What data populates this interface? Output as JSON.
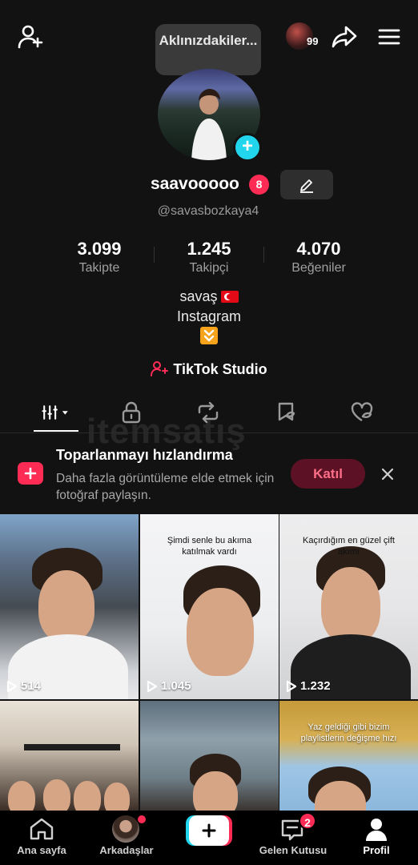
{
  "top_bar": {
    "thought_bubble": "Aklınızdakiler...",
    "mini_avatar_count": "99"
  },
  "profile": {
    "username": "saavooooo",
    "badge_count": "8",
    "handle": "@savasbozkaya4",
    "stats": [
      {
        "value": "3.099",
        "label": "Takipte"
      },
      {
        "value": "1.245",
        "label": "Takipçi"
      },
      {
        "value": "4.070",
        "label": "Beğeniler"
      }
    ],
    "bio_line1": "savaş",
    "bio_line2": "Instagram",
    "studio_label": "TikTok Studio"
  },
  "tabs": [
    "videos-tab",
    "private-tab",
    "reposts-tab",
    "favorites-tab",
    "liked-tab"
  ],
  "watermark": "itemsatış",
  "promo": {
    "title": "Toparlanmayı hızlandırma",
    "text": "Daha fazla görüntüleme elde etmek için fotoğraf paylaşın.",
    "button": "Katıl"
  },
  "videos": [
    {
      "views": "514",
      "caption": ""
    },
    {
      "views": "1.045",
      "caption": "Şimdi senle bu akıma katılmak vardı"
    },
    {
      "views": "1.232",
      "caption": "Kaçırdığım en güzel çift akımı"
    },
    {
      "views": "",
      "caption": ""
    },
    {
      "views": "",
      "caption": ""
    },
    {
      "views": "",
      "caption": "Yaz geldiği gibi bizim playlistlerin değişme hızı"
    }
  ],
  "nav": {
    "home": "Ana sayfa",
    "friends": "Arkadaşlar",
    "inbox": "Gelen Kutusu",
    "inbox_badge": "2",
    "profile": "Profil"
  },
  "colors": {
    "accent": "#fe2c55",
    "cyan": "#20d5ec",
    "background": "#121212"
  }
}
